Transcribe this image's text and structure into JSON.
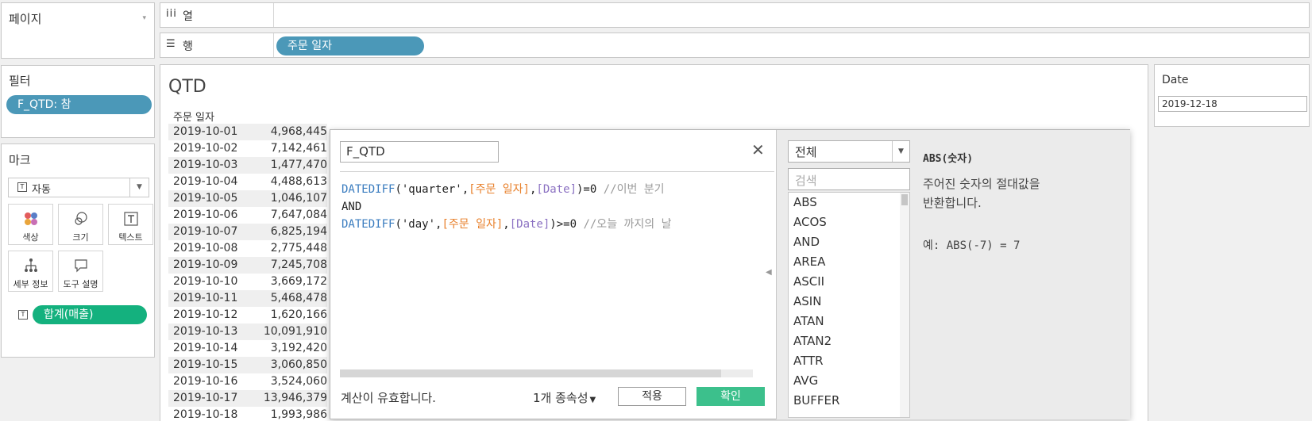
{
  "pages_card": {
    "title": "페이지"
  },
  "columns_shelf": {
    "icon": "iii",
    "label": "열"
  },
  "rows_shelf": {
    "icon": "☰",
    "label": "행",
    "pill": "주문 일자"
  },
  "filters_card": {
    "title": "필터",
    "pill": "F_QTD: 참"
  },
  "marks_card": {
    "title": "마크",
    "type_select": "자동",
    "buttons": [
      "색상",
      "크기",
      "텍스트",
      "세부 정보",
      "도구 설명"
    ],
    "measure_pill": "합계(매출)"
  },
  "view": {
    "title": "QTD",
    "column_header": "주문 일자",
    "rows": [
      {
        "date": "2019-10-01",
        "value": "4,968,445"
      },
      {
        "date": "2019-10-02",
        "value": "7,142,461"
      },
      {
        "date": "2019-10-03",
        "value": "1,477,470"
      },
      {
        "date": "2019-10-04",
        "value": "4,488,613"
      },
      {
        "date": "2019-10-05",
        "value": "1,046,107"
      },
      {
        "date": "2019-10-06",
        "value": "7,647,084"
      },
      {
        "date": "2019-10-07",
        "value": "6,825,194"
      },
      {
        "date": "2019-10-08",
        "value": "2,775,448"
      },
      {
        "date": "2019-10-09",
        "value": "7,245,708"
      },
      {
        "date": "2019-10-10",
        "value": "3,669,172"
      },
      {
        "date": "2019-10-11",
        "value": "5,468,478"
      },
      {
        "date": "2019-10-12",
        "value": "1,620,166"
      },
      {
        "date": "2019-10-13",
        "value": "10,091,910"
      },
      {
        "date": "2019-10-14",
        "value": "3,192,420"
      },
      {
        "date": "2019-10-15",
        "value": "3,060,850"
      },
      {
        "date": "2019-10-16",
        "value": "3,524,060"
      },
      {
        "date": "2019-10-17",
        "value": "13,946,379"
      },
      {
        "date": "2019-10-18",
        "value": "1,993,986"
      }
    ]
  },
  "parameter_card": {
    "title": "Date",
    "value": "2019-12-18"
  },
  "calc_editor": {
    "name": "F_QTD",
    "line1": {
      "fn": "DATEDIFF",
      "open": "(",
      "str": "'quarter'",
      "c1": ",",
      "field": "[주문 일자]",
      "c2": ",",
      "param": "[Date]",
      "close": ")=0",
      "comment": "//이번 분기"
    },
    "line2": {
      "op": "AND"
    },
    "line3": {
      "fn": "DATEDIFF",
      "open": "(",
      "str": "'day'",
      "c1": ",",
      "field": "[주문 일자]",
      "c2": ",",
      "param": "[Date]",
      "close": ")>=0",
      "comment": "//오늘 까지의 날"
    },
    "status": "계산이 유효합니다.",
    "dependencies": "1개 종속성",
    "apply_label": "적용",
    "ok_label": "확인"
  },
  "function_panel": {
    "category": "전체",
    "search_placeholder": "검색",
    "functions": [
      "ABS",
      "ACOS",
      "AND",
      "AREA",
      "ASCII",
      "ASIN",
      "ATAN",
      "ATAN2",
      "ATTR",
      "AVG",
      "BUFFER"
    ],
    "help_title": "ABS(숫자)",
    "help_desc_1": "주어진 숫자의 절대값을",
    "help_desc_2": "반환합니다.",
    "help_example": "예: ABS(-7) = 7"
  },
  "colors": {
    "pill_blue": "#4b98b8",
    "pill_green": "#14b17e",
    "ok_button": "#3cc08c",
    "function_blue": "#3a7cbf",
    "field_orange": "#e8812c",
    "param_purple": "#8b71c2"
  }
}
